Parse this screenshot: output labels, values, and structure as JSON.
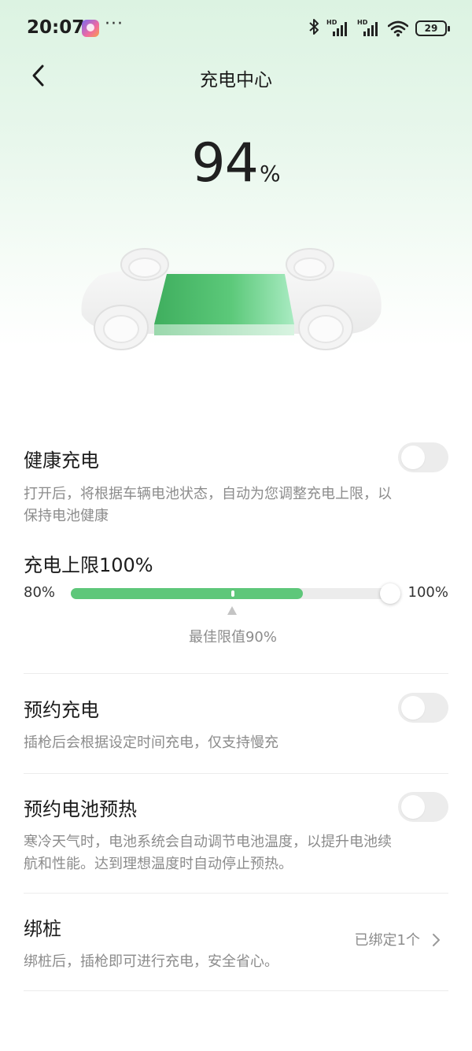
{
  "status_bar": {
    "time": "20:07",
    "dots": "···",
    "bluetooth": "✱",
    "signal_label": "HD",
    "battery": "29"
  },
  "header": {
    "title": "充电中心"
  },
  "battery": {
    "percent": "94",
    "unit": "%",
    "level": 0.94
  },
  "healthy_charging": {
    "title": "健康充电",
    "description": "打开后，将根据车辆电池状态，自动为您调整充电上限，以保持电池健康",
    "enabled": false
  },
  "charge_limit": {
    "title": "充电上限100%",
    "min_label": "80%",
    "max_label": "100%",
    "min": 80,
    "max": 100,
    "value": 100,
    "best": 90,
    "best_label": "最佳限值90%"
  },
  "scheduled_charging": {
    "title": "预约充电",
    "description": "插枪后会根据设定时间充电，仅支持慢充",
    "enabled": false
  },
  "battery_preheat": {
    "title": "预约电池预热",
    "description": "寒冷天气时，电池系统会自动调节电池温度，以提升电池续航和性能。达到理想温度时自动停止预热。",
    "enabled": false
  },
  "bind_charger": {
    "title": "绑桩",
    "description": "绑桩后，插枪即可进行充电，安全省心。",
    "value": "已绑定1个"
  },
  "colors": {
    "accent": "#5ec77a",
    "battery_green": "#4fbf6c",
    "toggle_off": "#ececec",
    "secondary_text": "#8c8c8c"
  }
}
